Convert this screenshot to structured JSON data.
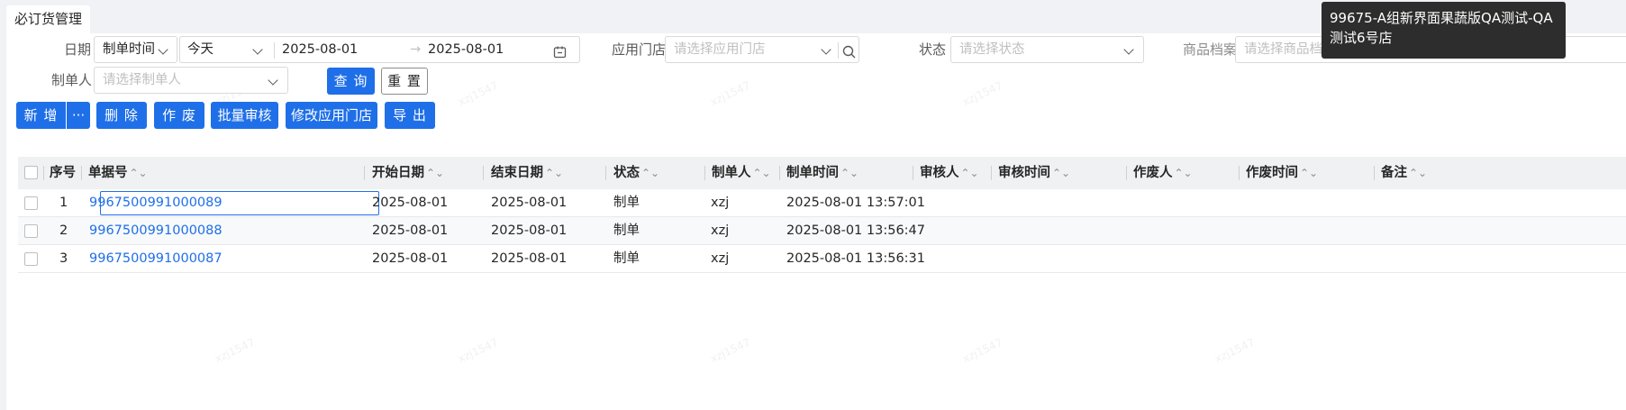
{
  "tab": {
    "title": "必订货管理"
  },
  "filters": {
    "date_label": "日期",
    "date_type": "制单时间",
    "date_range_preset": "今天",
    "date_start": "2025-08-01",
    "date_arrow": "→",
    "date_end": "2025-08-01",
    "store_label": "应用门店",
    "store_placeholder": "请选择应用门店",
    "status_label": "状态",
    "status_placeholder": "请选择状态",
    "product_label": "商品档案",
    "product_placeholder": "请选择商品档案",
    "creator_label": "制单人",
    "creator_placeholder": "请选择制单人",
    "query_button": "查 询",
    "reset_button": "重 置"
  },
  "toolbar": {
    "add": "新 增",
    "more": "···",
    "delete": "删 除",
    "void": "作 废",
    "batch_approve": "批量审核",
    "modify_store": "修改应用门店",
    "export": "导 出"
  },
  "table": {
    "headers": {
      "index": "序号",
      "doc_no": "单据号",
      "start_date": "开始日期",
      "end_date": "结束日期",
      "status": "状态",
      "creator": "制单人",
      "created_at": "制单时间",
      "approver": "审核人",
      "approved_at": "审核时间",
      "voider": "作废人",
      "voided_at": "作废时间",
      "remark": "备注"
    },
    "sort_icon": "⌃⌄",
    "rows": [
      {
        "index": "1",
        "doc_no": "9967500991000089",
        "start_date": "2025-08-01",
        "end_date": "2025-08-01",
        "status": "制单",
        "creator": "xzj",
        "created_at": "2025-08-01 13:57:01"
      },
      {
        "index": "2",
        "doc_no": "9967500991000088",
        "start_date": "2025-08-01",
        "end_date": "2025-08-01",
        "status": "制单",
        "creator": "xzj",
        "created_at": "2025-08-01 13:56:47"
      },
      {
        "index": "3",
        "doc_no": "9967500991000087",
        "start_date": "2025-08-01",
        "end_date": "2025-08-01",
        "status": "制单",
        "creator": "xzj",
        "created_at": "2025-08-01 13:56:31"
      }
    ]
  },
  "tooltip": {
    "text": "99675-A组新界面果蔬版QA测试-QA测试6号店"
  },
  "watermark": {
    "text": "xzj1547"
  },
  "colors": {
    "primary": "#1f6fe8",
    "tooltip_bg": "#2d2d2d"
  }
}
